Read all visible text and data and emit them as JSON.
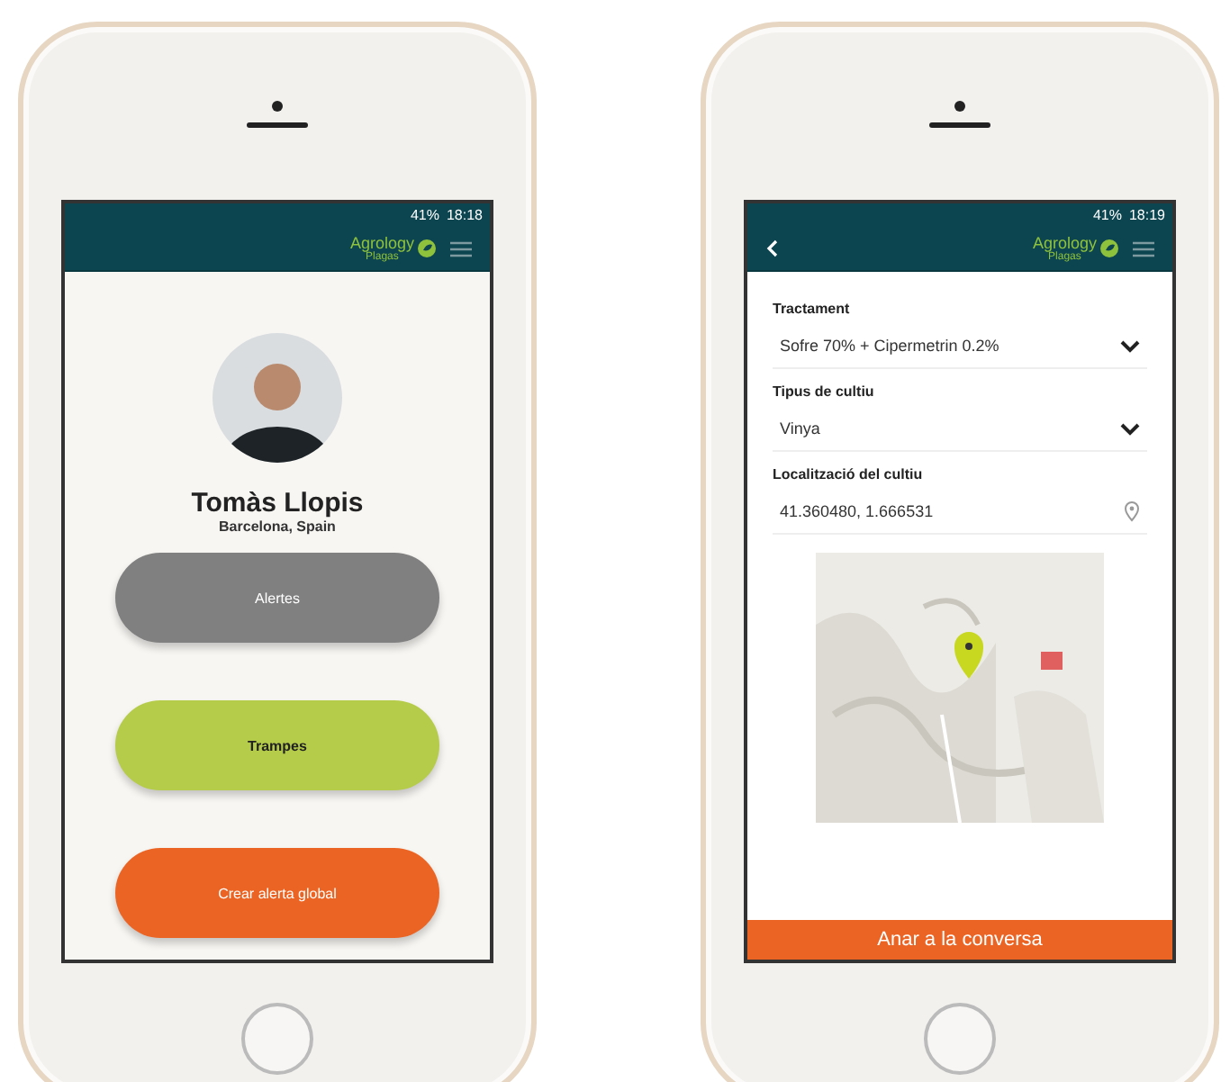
{
  "phones": [
    {
      "kind": "profile",
      "status_bar": {
        "battery": "41%",
        "time": "18:18"
      },
      "header": {
        "logo_top": "Agrology",
        "logo_bottom": "Plagas"
      },
      "profile": {
        "name": "Tomàs Llopis",
        "location": "Barcelona, Spain"
      },
      "buttons": [
        {
          "label": "Alertes",
          "color": "#808080"
        },
        {
          "label": "Trampes",
          "color": "#b5cc4a"
        },
        {
          "label": "Crear alerta global",
          "color": "#ec6424"
        }
      ]
    },
    {
      "kind": "form",
      "status_bar": {
        "battery": "41%",
        "time": "18:19"
      },
      "header": {
        "logo_top": "Agrology",
        "logo_bottom": "Plagas",
        "back": true
      },
      "fields": [
        {
          "kind": "select",
          "label": "Tractament",
          "value": "Sofre 70% + Cipermetrin 0.2%"
        },
        {
          "kind": "select",
          "label": "Tipus de cultiu",
          "value": "Vinya"
        },
        {
          "kind": "location",
          "label": "Localització del cultiu",
          "value": "41.360480, 1.666531"
        }
      ],
      "action": {
        "label": "Anar a la conversa"
      }
    }
  ]
}
